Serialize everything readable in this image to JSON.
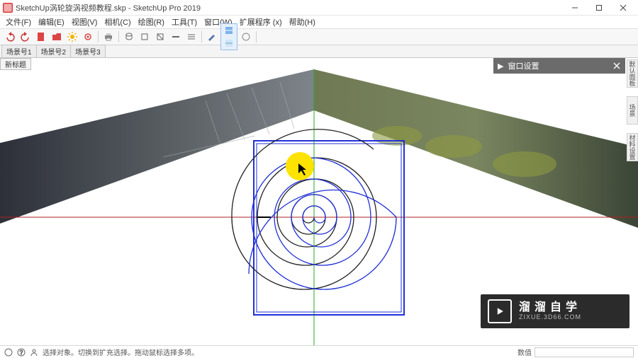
{
  "window": {
    "title": "SketchUp涡轮旋涡视频教程.skp - SketchUp Pro 2019"
  },
  "menu": [
    "文件(F)",
    "编辑(E)",
    "视图(V)",
    "相机(C)",
    "绘图(R)",
    "工具(T)",
    "窗口(W)",
    "扩展程序 (x)",
    "帮助(H)"
  ],
  "scene_tabs": [
    "场景号1",
    "场景号2",
    "场景号3"
  ],
  "viewport_tab": "新标题",
  "right_vertical": [
    "默认面板",
    "场景",
    "材料设置"
  ],
  "panel": {
    "title": "窗口设置"
  },
  "watermark": {
    "cn": "溜溜自学",
    "en": "ZIXUE.3D66.COM"
  },
  "status": {
    "hint": "选择对象。切换到扩充选择。拖动鼠标选择多项。",
    "measure_label": "数值"
  },
  "colors": {
    "axis_red": "#b02020",
    "axis_green": "#1fae1f",
    "axis_blue": "#2030d8",
    "highlight_yellow": "#fee300"
  }
}
